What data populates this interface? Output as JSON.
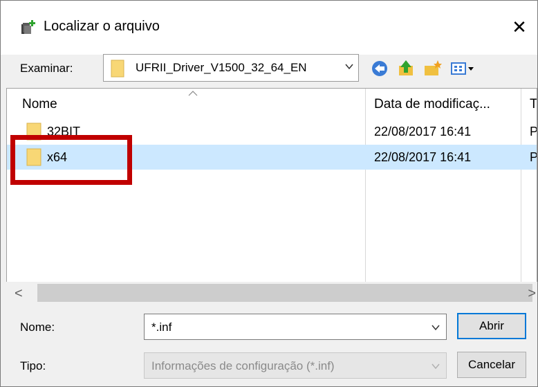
{
  "window": {
    "title": "Localizar o arquivo",
    "close_glyph": "✕"
  },
  "toolbar": {
    "look_in_label": "Examinar:",
    "current_folder": "UFRII_Driver_V1500_32_64_EN",
    "icons": [
      "back-icon",
      "up-folder-icon",
      "new-folder-icon",
      "view-menu-icon"
    ]
  },
  "list": {
    "columns": [
      "Nome",
      "Data de modificaç...",
      "Ti"
    ],
    "rows": [
      {
        "name": "32BIT",
        "modified": "22/08/2017 16:41",
        "type": "Pa",
        "selected": false
      },
      {
        "name": "x64",
        "modified": "22/08/2017 16:41",
        "type": "Pa",
        "selected": true
      }
    ]
  },
  "scrollbar": {
    "left_glyph": "<",
    "right_glyph": ">"
  },
  "form": {
    "name_label": "Nome:",
    "name_value": "*.inf",
    "type_label": "Tipo:",
    "type_value": "Informações de configuração (*.inf)",
    "open_button": "Abrir",
    "cancel_button": "Cancelar"
  },
  "colors": {
    "selection": "#cce8ff",
    "highlight": "#c00000",
    "folder": "#f8d775"
  }
}
